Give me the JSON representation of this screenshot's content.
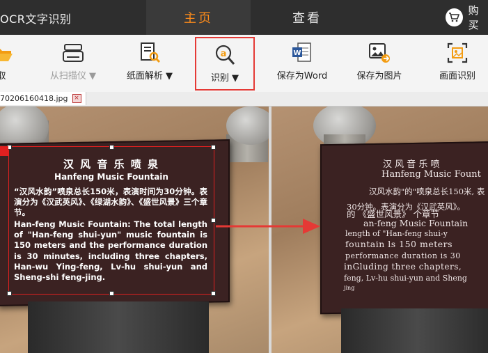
{
  "titlebar": {
    "app_title": "OCR文字识别",
    "tabs": [
      {
        "label": "主页"
      },
      {
        "label": "查看"
      }
    ],
    "buy_label": "购买"
  },
  "toolbar": {
    "items": [
      {
        "label": "取",
        "icon": "folder-open-icon"
      },
      {
        "label": "从扫描仪 ▼",
        "icon": "scanner-icon"
      },
      {
        "label": "纸面解析 ▼",
        "icon": "document-search-icon"
      },
      {
        "label": "识别 ▼",
        "icon": "recognize-a-icon"
      },
      {
        "label": "保存为Word",
        "icon": "word-document-icon"
      },
      {
        "label": "保存为图片",
        "icon": "save-image-icon"
      },
      {
        "label": "画面识别",
        "icon": "screen-capture-icon"
      }
    ]
  },
  "file_tab": {
    "name": "70206160418.jpg",
    "close": "×"
  },
  "left_image": {
    "title_cn": "汉 风 音 乐 喷 泉",
    "title_en": "Hanfeng Music Fountain",
    "body_cn": "“汉风水韵”喷泉总长150米，表演时间为30分钟。表演分为《汉武英风》、《绿湖水韵》、《盛世风景》三个章节。",
    "body_en": "Han-feng Music Fountain: The total length of \"Han-feng shui-yun\" music fountain is 150 meters and the performance duration is 30 minutes, including three chapters, Han-wu Ying-feng, Lv-hu shui-yun and Sheng-shi feng-jing."
  },
  "right_image": {
    "line1": "汉  风  音  乐  喷",
    "line2": "Hanfeng Music Fount",
    "line3": "汉风水韵\"的\"喷泉总长150米,  表",
    "line4": "30分钟。表演分为《汉武英风》。",
    "line5": "的  《盛世风景》  个章节",
    "line6": "an-feng Music Fountain",
    "line7": "length  of  \"Han-feng  shui-y",
    "line8": "fountain  ls  150  meters",
    "line9": "performance  duration  is  30",
    "line10": "inGluding  three  chapters,",
    "line11": "feng,  Lv-hu  shui-yun  and  Sheng",
    "line12": "jing"
  },
  "colors": {
    "accent": "#ff8c1a",
    "titlebar": "#2e2e2e",
    "highlight": "#e53935",
    "arrow": "#e53935"
  }
}
